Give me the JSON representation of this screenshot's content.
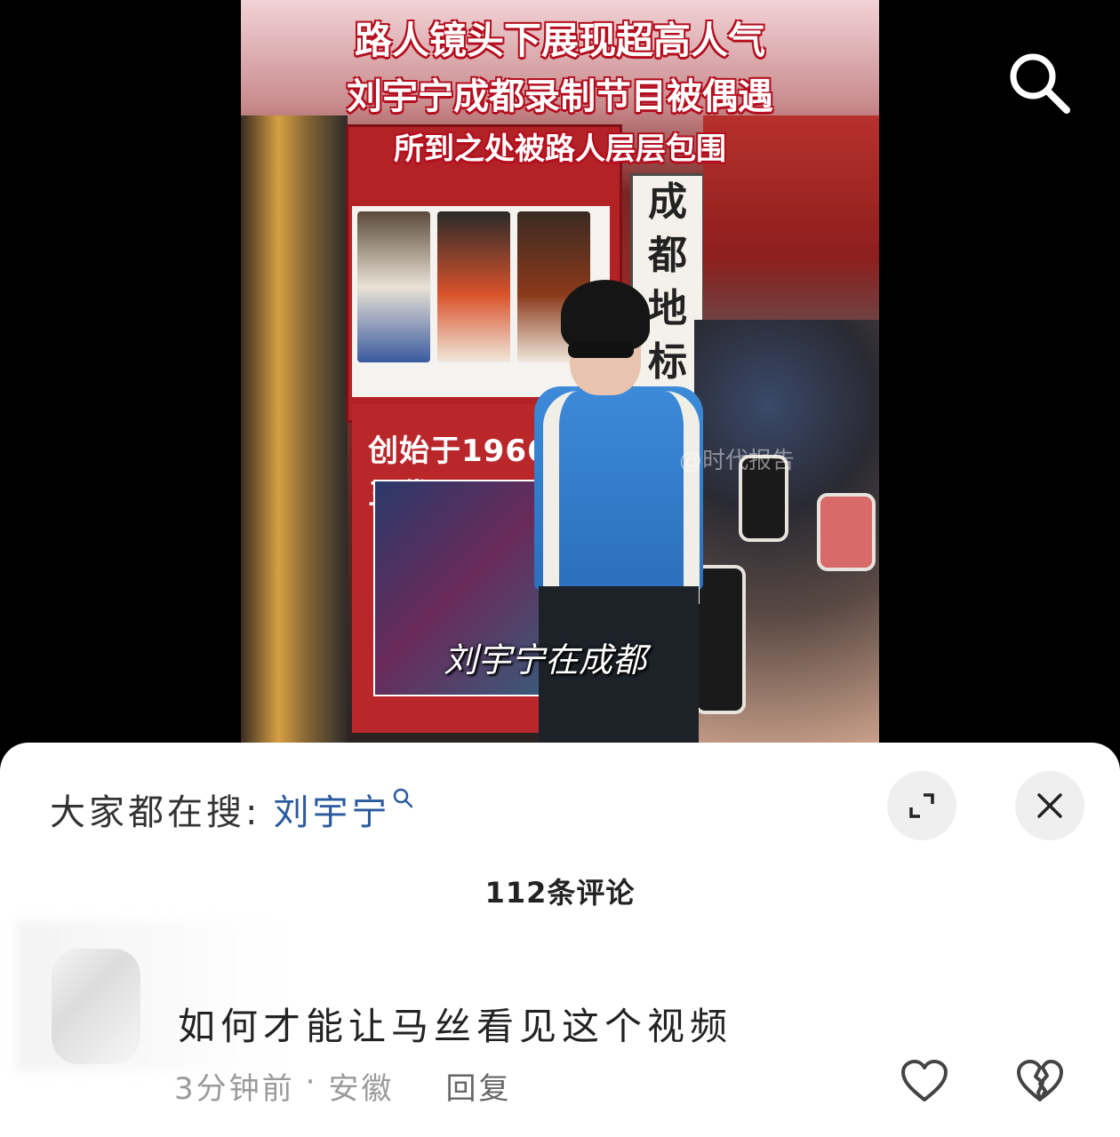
{
  "video": {
    "title_lines": [
      "路人镜头下展现超高人气",
      "刘宇宁成都录制节目被偶遇",
      "所到之处被路人层层包围"
    ],
    "subtitle": "刘宇宁在成都",
    "sign_text": [
      "成",
      "都",
      "地",
      "标"
    ],
    "board_text": "创始于1966年 三代",
    "watermark": "@时代报告",
    "search_icon": "search-icon"
  },
  "sheet": {
    "trending_label": "大家都在搜:",
    "trending_keyword": "刘宇宁",
    "comment_count": "112条评论",
    "expand_icon": "expand-icon",
    "close_icon": "close-icon"
  },
  "comments": [
    {
      "text": "如何才能让马丝看见这个视频",
      "time": "3分钟前",
      "separator": "·",
      "location": "安徽",
      "reply_label": "回复",
      "like_icon": "heart-icon",
      "dislike_icon": "broken-heart-icon"
    }
  ],
  "colors": {
    "keyword": "#2a5a9e",
    "title_stroke": "#b40e1e"
  }
}
